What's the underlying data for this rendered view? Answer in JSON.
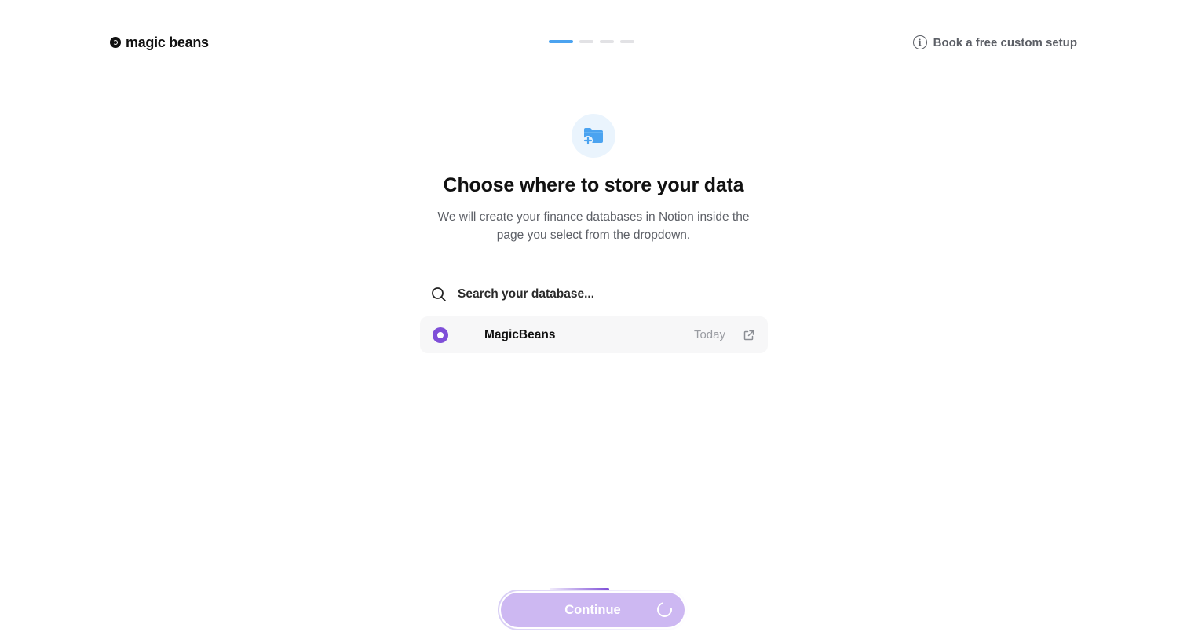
{
  "header": {
    "brand_name": "magic beans",
    "setup_link_label": "Book a free custom setup",
    "steps_total": 4,
    "current_step": 1
  },
  "hero": {
    "title": "Choose where to store your data",
    "subtitle": "We will create your finance databases in Notion inside the page you select from the dropdown."
  },
  "search": {
    "placeholder": "Search your database..."
  },
  "databases": [
    {
      "name": "MagicBeans",
      "date": "Today",
      "selected": true
    }
  ],
  "footer": {
    "continue_label": "Continue"
  },
  "colors": {
    "accent_purple": "#7f4fd8",
    "button_purple": "#cdb8f2",
    "step_active": "#4ba3f0",
    "icon_blue": "#4ba3f0"
  },
  "icons": {
    "brand": "magic-beans-logo-icon",
    "info": "info-icon",
    "hero": "folder-plus-icon",
    "search": "search-icon",
    "external": "external-link-icon",
    "loading": "spinner-icon"
  }
}
